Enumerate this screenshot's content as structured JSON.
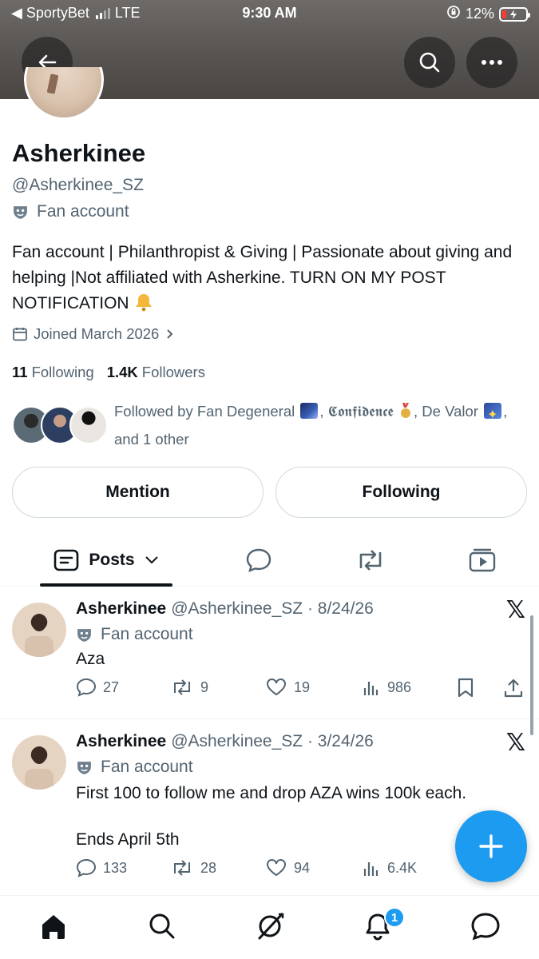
{
  "status_bar": {
    "carrier": "◀ SportyBet",
    "network": "LTE",
    "time": "9:30 AM",
    "battery": "12%",
    "battery_color": "#ff3b30"
  },
  "header": {
    "back_icon": "arrow-left-icon",
    "search_icon": "search-icon",
    "more_icon": "more-icon"
  },
  "profile": {
    "name": "Asherkinee",
    "handle": "@Asherkinee_SZ",
    "label": "Fan account",
    "bio": "Fan account | Philanthropist & Giving | Passionate about giving and helping |Not affiliated with Asherkine. TURN ON MY POST NOTIFICATION",
    "joined": "Joined March 2026",
    "following_count": "11",
    "following_label": "Following",
    "followers_count": "1.4K",
    "followers_label": "Followers",
    "followed_by_prefix": "Followed by Fan Degeneral",
    "followed_by_second": "𝕮𝖔𝖓𝖋𝖎𝖉𝖊𝖓𝖈𝖊",
    "followed_by_third": ", De Valor",
    "followed_by_suffix": ", and 1 other"
  },
  "actions": {
    "mention": "Mention",
    "following": "Following"
  },
  "tabs": {
    "posts": "Posts"
  },
  "posts": [
    {
      "author": "Asherkinee",
      "meta": "@Asherkinee_SZ · 8/24/26",
      "label": "Fan account",
      "text": "Aza",
      "text2": "",
      "replies": "27",
      "reposts": "9",
      "likes": "19",
      "views": "986"
    },
    {
      "author": "Asherkinee",
      "meta": "@Asherkinee_SZ · 3/24/26",
      "label": "Fan account",
      "text": "First 100 to follow me and drop AZA wins 100k each.",
      "text2": "Ends April 5th",
      "replies": "133",
      "reposts": "28",
      "likes": "94",
      "views": "6.4K"
    }
  ],
  "x_logo": "𝕏",
  "notifications_badge": "1",
  "accent_color": "#1d9bf0"
}
